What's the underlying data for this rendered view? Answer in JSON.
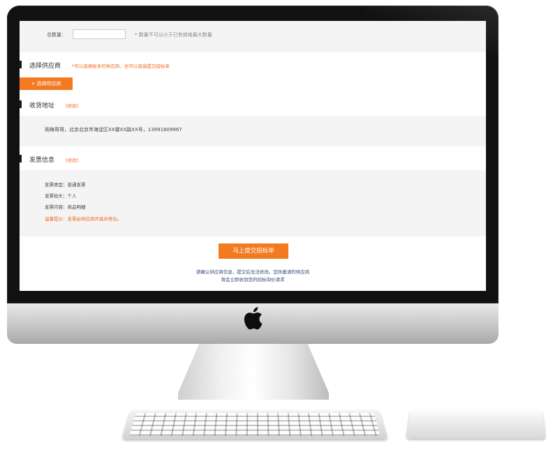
{
  "screen": {
    "quantity": {
      "label": "总数量：",
      "value": "",
      "hint": "* 数量不可以小于已有规格最大数量"
    },
    "supplier": {
      "title": "选择供应商",
      "note": "*可以选择帐多的供应商，也可以直接提交招标单",
      "button_label": "+ 选择供应商"
    },
    "shipping": {
      "title": "收货地址",
      "edit_label": "[修改]",
      "address": "雨梅哥哥，北京北京市海淀区XX楼XX路XX号，13991809967"
    },
    "invoice": {
      "title": "发票信息",
      "edit_label": "[修改]",
      "type": "发票类型：普通发票",
      "header": "发票抬头：个人",
      "content": "发票内容：商品明细",
      "tip": "温馨提示：发票由供应商开具并寄出。"
    },
    "submit_label": "马上提交招标单",
    "confirm_line1": "请确认供应商信息，提交后无法修改。您所邀请的供应商",
    "confirm_line2": "将会立即收到您的招标询价请求"
  },
  "colors": {
    "accent": "#f47a20",
    "panel_gray": "#f4f4f4",
    "bezel": "#111111"
  },
  "icons": {
    "apple": "apple-logo-icon"
  }
}
